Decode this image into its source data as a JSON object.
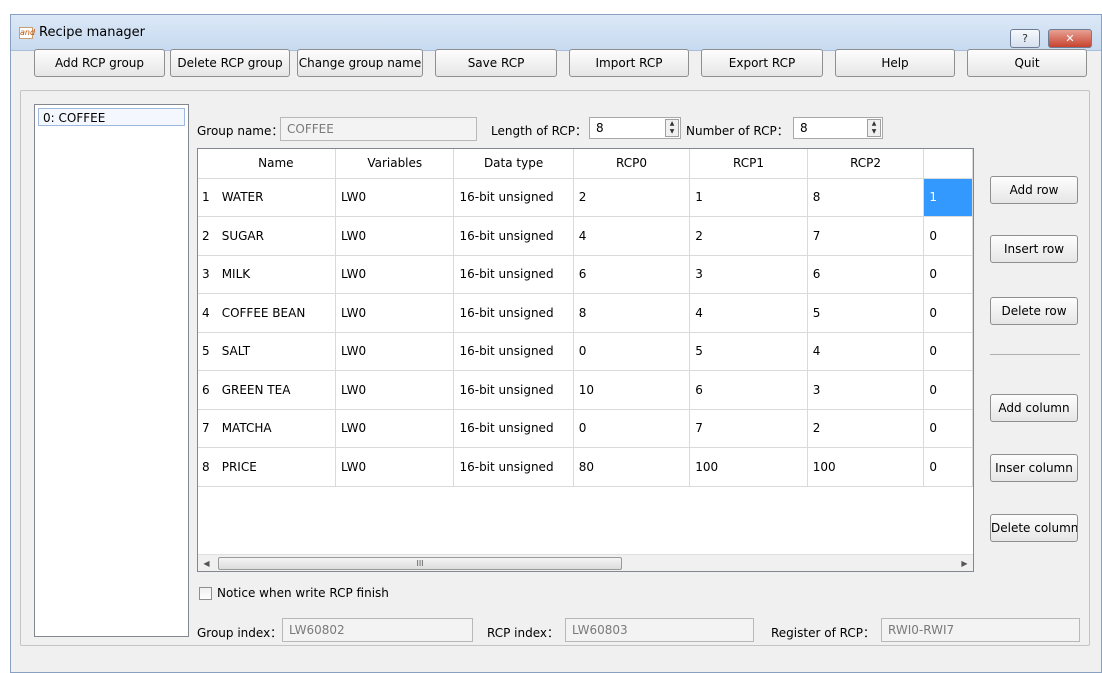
{
  "window": {
    "title": "Recipe manager",
    "app_icon_text": "and",
    "help_glyph": "?",
    "close_glyph": "✕"
  },
  "toolbar": {
    "add_group": "Add RCP group",
    "delete_group": "Delete RCP group",
    "change_name": "Change group name",
    "save": "Save RCP",
    "import": "Import RCP",
    "export": "Export RCP",
    "help": "Help",
    "quit": "Quit"
  },
  "groups": [
    "0: COFFEE"
  ],
  "form": {
    "group_name_label": "Group name：",
    "group_name_value": "COFFEE",
    "length_label": "Length of RCP：",
    "length_value": "8",
    "number_label": "Number of RCP：",
    "number_value": "8"
  },
  "table": {
    "headers": [
      "Name",
      "Variables",
      "Data type",
      "RCP0",
      "RCP1",
      "RCP2"
    ],
    "rows": [
      {
        "num": "1",
        "name": "WATER",
        "var": "LW0",
        "type": "16-bit unsigned",
        "rcp0": "2",
        "rcp1": "1",
        "rcp2": "8",
        "rcp3": "1"
      },
      {
        "num": "2",
        "name": "SUGAR",
        "var": "LW0",
        "type": "16-bit unsigned",
        "rcp0": "4",
        "rcp1": "2",
        "rcp2": "7",
        "rcp3": "0"
      },
      {
        "num": "3",
        "name": "MILK",
        "var": "LW0",
        "type": "16-bit unsigned",
        "rcp0": "6",
        "rcp1": "3",
        "rcp2": "6",
        "rcp3": "0"
      },
      {
        "num": "4",
        "name": "COFFEE BEAN",
        "var": "LW0",
        "type": "16-bit unsigned",
        "rcp0": "8",
        "rcp1": "4",
        "rcp2": "5",
        "rcp3": "0"
      },
      {
        "num": "5",
        "name": "SALT",
        "var": "LW0",
        "type": "16-bit unsigned",
        "rcp0": "0",
        "rcp1": "5",
        "rcp2": "4",
        "rcp3": "0"
      },
      {
        "num": "6",
        "name": "GREEN TEA",
        "var": "LW0",
        "type": "16-bit unsigned",
        "rcp0": "10",
        "rcp1": "6",
        "rcp2": "3",
        "rcp3": "0"
      },
      {
        "num": "7",
        "name": "MATCHA",
        "var": "LW0",
        "type": "16-bit unsigned",
        "rcp0": "0",
        "rcp1": "7",
        "rcp2": "2",
        "rcp3": "0"
      },
      {
        "num": "8",
        "name": "PRICE",
        "var": "LW0",
        "type": "16-bit unsigned",
        "rcp0": "80",
        "rcp1": "100",
        "rcp2": "100",
        "rcp3": "0"
      }
    ],
    "scroll_thumb_grip": "III",
    "scroll_left": "◀",
    "scroll_right": "▶"
  },
  "side_buttons": {
    "add_row": "Add row",
    "insert_row": "Insert row",
    "delete_row": "Delete row",
    "add_column": "Add column",
    "insert_column": "Inser column",
    "delete_column": "Delete column"
  },
  "footer": {
    "notice_label": "Notice when write RCP finish",
    "group_index_label": "Group index：",
    "group_index_value": "LW60802",
    "rcp_index_label": "RCP index：",
    "rcp_index_value": "LW60803",
    "register_label": "Register of RCP：",
    "register_value": "RWI0-RWI7"
  },
  "colors": {
    "selection": "#3399ff",
    "title_bar": "#c8daf0",
    "close_button": "#c7442f"
  }
}
